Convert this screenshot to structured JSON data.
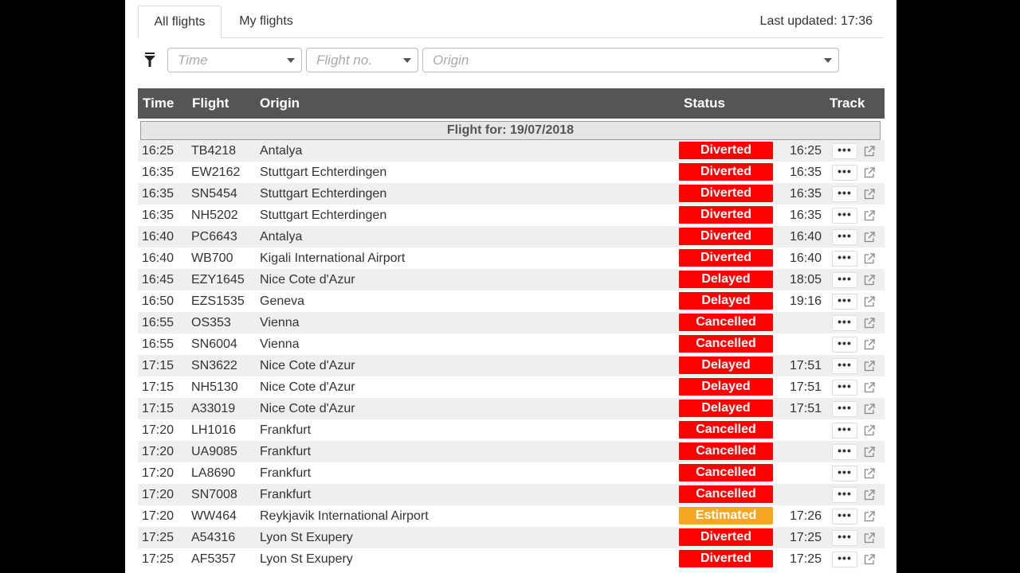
{
  "tabs": [
    {
      "label": "All flights",
      "active": true
    },
    {
      "label": "My flights",
      "active": false
    }
  ],
  "last_updated": "Last updated: 17:36",
  "filters": {
    "time_placeholder": "Time",
    "flight_placeholder": "Flight no.",
    "origin_placeholder": "Origin"
  },
  "table": {
    "headers": {
      "time": "Time",
      "flight": "Flight",
      "origin": "Origin",
      "status": "Status",
      "track": "Track"
    },
    "date_label": "Flight for: 19/07/2018",
    "more_label": "•••",
    "status_colors": {
      "Diverted": "#ff0000",
      "Delayed": "#ff0000",
      "Cancelled": "#ff0000",
      "Estimated": "#f5a623"
    },
    "rows": [
      {
        "time": "16:25",
        "flight": "TB4218",
        "origin": "Antalya",
        "status": "Diverted",
        "estimated": "16:25"
      },
      {
        "time": "16:35",
        "flight": "EW2162",
        "origin": "Stuttgart Echterdingen",
        "status": "Diverted",
        "estimated": "16:35"
      },
      {
        "time": "16:35",
        "flight": "SN5454",
        "origin": "Stuttgart Echterdingen",
        "status": "Diverted",
        "estimated": "16:35"
      },
      {
        "time": "16:35",
        "flight": "NH5202",
        "origin": "Stuttgart Echterdingen",
        "status": "Diverted",
        "estimated": "16:35"
      },
      {
        "time": "16:40",
        "flight": "PC6643",
        "origin": "Antalya",
        "status": "Diverted",
        "estimated": "16:40"
      },
      {
        "time": "16:40",
        "flight": "WB700",
        "origin": "Kigali International Airport",
        "status": "Diverted",
        "estimated": "16:40"
      },
      {
        "time": "16:45",
        "flight": "EZY1645",
        "origin": "Nice Cote d'Azur",
        "status": "Delayed",
        "estimated": "18:05"
      },
      {
        "time": "16:50",
        "flight": "EZS1535",
        "origin": "Geneva",
        "status": "Delayed",
        "estimated": "19:16"
      },
      {
        "time": "16:55",
        "flight": "OS353",
        "origin": "Vienna",
        "status": "Cancelled",
        "estimated": ""
      },
      {
        "time": "16:55",
        "flight": "SN6004",
        "origin": "Vienna",
        "status": "Cancelled",
        "estimated": ""
      },
      {
        "time": "17:15",
        "flight": "SN3622",
        "origin": "Nice Cote d'Azur",
        "status": "Delayed",
        "estimated": "17:51"
      },
      {
        "time": "17:15",
        "flight": "NH5130",
        "origin": "Nice Cote d'Azur",
        "status": "Delayed",
        "estimated": "17:51"
      },
      {
        "time": "17:15",
        "flight": "A33019",
        "origin": "Nice Cote d'Azur",
        "status": "Delayed",
        "estimated": "17:51"
      },
      {
        "time": "17:20",
        "flight": "LH1016",
        "origin": "Frankfurt",
        "status": "Cancelled",
        "estimated": ""
      },
      {
        "time": "17:20",
        "flight": "UA9085",
        "origin": "Frankfurt",
        "status": "Cancelled",
        "estimated": ""
      },
      {
        "time": "17:20",
        "flight": "LA8690",
        "origin": "Frankfurt",
        "status": "Cancelled",
        "estimated": ""
      },
      {
        "time": "17:20",
        "flight": "SN7008",
        "origin": "Frankfurt",
        "status": "Cancelled",
        "estimated": ""
      },
      {
        "time": "17:20",
        "flight": "WW464",
        "origin": "Reykjavik International Airport",
        "status": "Estimated",
        "estimated": "17:26"
      },
      {
        "time": "17:25",
        "flight": "A54316",
        "origin": "Lyon St Exupery",
        "status": "Diverted",
        "estimated": "17:25"
      },
      {
        "time": "17:25",
        "flight": "AF5357",
        "origin": "Lyon St Exupery",
        "status": "Diverted",
        "estimated": "17:25"
      }
    ]
  }
}
